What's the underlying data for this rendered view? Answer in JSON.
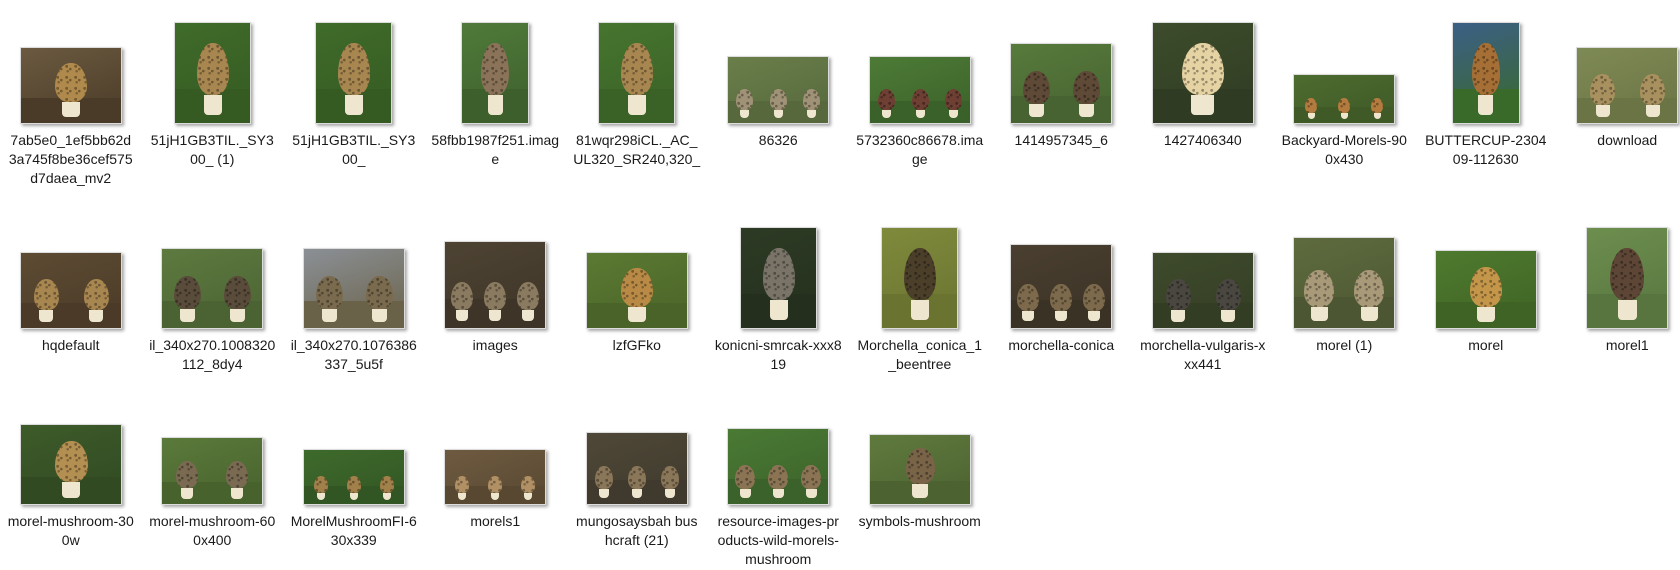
{
  "files": [
    {
      "name": "7ab5e0_1ef5bb62d3a745f8be36cef575d7daea_mv2",
      "w": 100,
      "h": 75,
      "bg": "#6b5a40",
      "ground": "#4a3b28",
      "cap": "#b08a4c",
      "shrooms": 1
    },
    {
      "name": "51jH1GB3TIL._SY300_ (1)",
      "w": 75,
      "h": 100,
      "bg": "#3f6b2a",
      "ground": "#355a22",
      "cap": "#a88650",
      "shrooms": 1
    },
    {
      "name": "51jH1GB3TIL._SY300_",
      "w": 75,
      "h": 100,
      "bg": "#3f6b2a",
      "ground": "#355a22",
      "cap": "#a88650",
      "shrooms": 1
    },
    {
      "name": "58fbb1987f251.image",
      "w": 66,
      "h": 100,
      "bg": "#4f7a3a",
      "ground": "#3d5f2c",
      "cap": "#8a7358",
      "shrooms": 1
    },
    {
      "name": "81wqr298iCL._AC_UL320_SR240,320_",
      "w": 75,
      "h": 100,
      "bg": "#46752f",
      "ground": "#3a6126",
      "cap": "#a88650",
      "shrooms": 1
    },
    {
      "name": "86326",
      "w": 100,
      "h": 66,
      "bg": "#6a7e4a",
      "ground": "#56683c",
      "cap": "#9f9276",
      "shrooms": 3
    },
    {
      "name": "5732360c86678.image",
      "w": 100,
      "h": 66,
      "bg": "#4d7b36",
      "ground": "#3b612a",
      "cap": "#6e3f33",
      "shrooms": 3
    },
    {
      "name": "1414957345_6",
      "w": 100,
      "h": 79,
      "bg": "#577a3c",
      "ground": "#466331",
      "cap": "#5e4a36",
      "shrooms": 2
    },
    {
      "name": "1427406340",
      "w": 100,
      "h": 100,
      "bg": "#3d4c2c",
      "ground": "#2f3b22",
      "cap": "#e6d3a3",
      "shrooms": 1
    },
    {
      "name": "Backyard-Morels-900x430",
      "w": 100,
      "h": 48,
      "bg": "#4d6c2f",
      "ground": "#3f5927",
      "cap": "#b47b3e",
      "shrooms": 3
    },
    {
      "name": "BUTTERCUP-230409-112630",
      "w": 66,
      "h": 100,
      "bg": "#3b5f86",
      "ground": "#3a6a2a",
      "cap": "#a66f35",
      "shrooms": 1
    },
    {
      "name": "download",
      "w": 100,
      "h": 75,
      "bg": "#7e8a55",
      "ground": "#6b7445",
      "cap": "#a8915e",
      "shrooms": 2
    },
    {
      "name": "hqdefault",
      "w": 100,
      "h": 75,
      "bg": "#5d4b33",
      "ground": "#4a3a27",
      "cap": "#a88650",
      "shrooms": 2
    },
    {
      "name": "il_340x270.1008320112_8dy4",
      "w": 100,
      "h": 79,
      "bg": "#5d7a3f",
      "ground": "#4b6333",
      "cap": "#5a4c3a",
      "shrooms": 2
    },
    {
      "name": "il_340x270.1076386337_5u5f",
      "w": 100,
      "h": 79,
      "bg": "#8b9096",
      "ground": "#6a6248",
      "cap": "#7a6a4e",
      "shrooms": 2
    },
    {
      "name": "images",
      "w": 100,
      "h": 86,
      "bg": "#4e4333",
      "ground": "#3e3528",
      "cap": "#8a7a60",
      "shrooms": 3
    },
    {
      "name": "lzfGFko",
      "w": 100,
      "h": 75,
      "bg": "#5b7a32",
      "ground": "#4a6328",
      "cap": "#b88a45",
      "shrooms": 1
    },
    {
      "name": "konicni-smrcak-xxx819",
      "w": 75,
      "h": 100,
      "bg": "#2d3a24",
      "ground": "#24301d",
      "cap": "#7a7468",
      "shrooms": 1
    },
    {
      "name": "Morchella_conica_1_beentree",
      "w": 75,
      "h": 100,
      "bg": "#7f8a3c",
      "ground": "#6a7330",
      "cap": "#4b3f2a",
      "shrooms": 1
    },
    {
      "name": "morchella-conica",
      "w": 100,
      "h": 83,
      "bg": "#4a3f30",
      "ground": "#3b3226",
      "cap": "#7d6a4c",
      "shrooms": 3
    },
    {
      "name": "morchella-vulgaris-xxx441",
      "w": 100,
      "h": 75,
      "bg": "#3f4b2c",
      "ground": "#333d24",
      "cap": "#4a4640",
      "shrooms": 2
    },
    {
      "name": "morel (1)",
      "w": 100,
      "h": 90,
      "bg": "#5e6b3e",
      "ground": "#4c5632",
      "cap": "#a89978",
      "shrooms": 2
    },
    {
      "name": "morel",
      "w": 100,
      "h": 77,
      "bg": "#4e7a2e",
      "ground": "#3f6325",
      "cap": "#c4964a",
      "shrooms": 1
    },
    {
      "name": "morel1",
      "w": 80,
      "h": 100,
      "bg": "#6c8e4e",
      "ground": "#587540",
      "cap": "#5e4636",
      "shrooms": 1
    },
    {
      "name": "morel-mushroom-300w",
      "w": 100,
      "h": 79,
      "bg": "#3d5b2a",
      "ground": "#314a22",
      "cap": "#b48f52",
      "shrooms": 1
    },
    {
      "name": "morel-mushroom-600x400",
      "w": 100,
      "h": 66,
      "bg": "#5a7a3a",
      "ground": "#48622e",
      "cap": "#7a6a52",
      "shrooms": 2
    },
    {
      "name": "MorelMushroomFI-630x339",
      "w": 100,
      "h": 54,
      "bg": "#3e6a2c",
      "ground": "#325623",
      "cap": "#a2804a",
      "shrooms": 3
    },
    {
      "name": "morels1",
      "w": 100,
      "h": 54,
      "bg": "#6e5a40",
      "ground": "#584832",
      "cap": "#b09064",
      "shrooms": 3
    },
    {
      "name": "mungosaysbah bushcraft (21)",
      "w": 100,
      "h": 71,
      "bg": "#4f4838",
      "ground": "#3f3a2d",
      "cap": "#8a7658",
      "shrooms": 3
    },
    {
      "name": "resource-images-products-wild-morels-mushroom",
      "w": 100,
      "h": 75,
      "bg": "#4a7a34",
      "ground": "#3b622a",
      "cap": "#8a7454",
      "shrooms": 3
    },
    {
      "name": "symbols-mushroom",
      "w": 100,
      "h": 69,
      "bg": "#5f7a3d",
      "ground": "#4c6231",
      "cap": "#7a6448",
      "shrooms": 1
    }
  ]
}
